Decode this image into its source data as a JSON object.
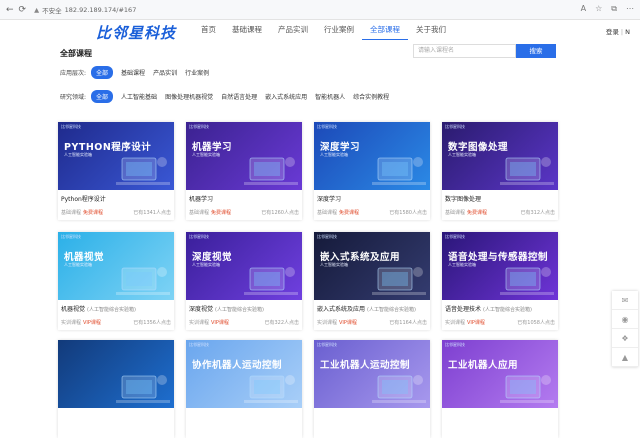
{
  "browser": {
    "security": "不安全",
    "url": "182.92.189.174/#167"
  },
  "header": {
    "logo": "比邻星科技",
    "menu": [
      "首页",
      "基础课程",
      "产品实训",
      "行业案例",
      "全部课程",
      "关于我们"
    ],
    "active_index": 4,
    "login": "登录",
    "register": "N"
  },
  "page": {
    "title": "全部课程",
    "search_placeholder": "请输入课程名",
    "search_button": "搜索"
  },
  "filters": [
    {
      "label": "应用层次:",
      "options": [
        "全部",
        "基础课程",
        "产品实训",
        "行业案例"
      ],
      "selected": 0
    },
    {
      "label": "研究领域:",
      "options": [
        "全部",
        "人工智能基础",
        "图像处理机器视觉",
        "自然语言处理",
        "嵌入式系统应用",
        "智能机器人",
        "综合实例教程"
      ],
      "selected": 0
    }
  ],
  "cards": [
    {
      "brand": "比邻星科技",
      "title": "PYTHON程序设计",
      "sub": "人工智能实验箱",
      "name": "Python程序设计",
      "note": "",
      "level": "基础课程",
      "price": "免费课程",
      "count": "已有1341人点击",
      "bg": "#1f2a8c",
      "bg2": "#3a58d6"
    },
    {
      "brand": "比邻星科技",
      "title": "机器学习",
      "sub": "人工智能实验箱",
      "name": "机器学习",
      "note": "",
      "level": "基础课程",
      "price": "免费课程",
      "count": "已有1260人点击",
      "bg": "#3b2290",
      "bg2": "#6a3ad6"
    },
    {
      "brand": "比邻星科技",
      "title": "深度学习",
      "sub": "人工智能实验箱",
      "name": "深度学习",
      "note": "",
      "level": "基础课程",
      "price": "免费课程",
      "count": "已有1580人点击",
      "bg": "#1c49b8",
      "bg2": "#2b8ae6"
    },
    {
      "brand": "比邻星科技",
      "title": "数字图像处理",
      "sub": "人工智能实验箱",
      "name": "数字图像处理",
      "note": "",
      "level": "基础课程",
      "price": "免费课程",
      "count": "已有312人点击",
      "bg": "#2a1b6e",
      "bg2": "#5b36c8"
    },
    {
      "brand": "比邻星科技",
      "title": "机器视觉",
      "sub": "人工智能实验箱",
      "name": "机器视觉",
      "note": "(人工智能综合实验箱)",
      "level": "实训课程",
      "price": "VIP课程",
      "count": "已有1356人点击",
      "bg": "#2bb0e8",
      "bg2": "#7fd3f5"
    },
    {
      "brand": "比邻星科技",
      "title": "深度视觉",
      "sub": "人工智能实验箱",
      "name": "深度视觉",
      "note": "(人工智能综合实验箱)",
      "level": "实训课程",
      "price": "VIP课程",
      "count": "已有322人点击",
      "bg": "#3a1f9a",
      "bg2": "#7040e0"
    },
    {
      "brand": "比邻星科技",
      "title": "嵌入式系统及应用",
      "sub": "人工智能实验箱",
      "name": "嵌入式系统及应用",
      "note": "(人工智能综合实验箱)",
      "level": "实训课程",
      "price": "VIP课程",
      "count": "已有1164人点击",
      "bg": "#151a3a",
      "bg2": "#343c70"
    },
    {
      "brand": "比邻星科技",
      "title": "语音处理与传感器控制",
      "sub": "人工智能实验箱",
      "name": "语音处理技术",
      "note": "(人工智能综合实验箱)",
      "level": "实训课程",
      "price": "VIP课程",
      "count": "已有1058人点击",
      "bg": "#2a1678",
      "bg2": "#6f34d8"
    },
    {
      "brand": "",
      "title": "",
      "sub": "",
      "name": "",
      "note": "",
      "level": "",
      "price": "",
      "count": "",
      "bg": "#123a7a",
      "bg2": "#1e6fd0"
    },
    {
      "brand": "比邻星科技",
      "title": "协作机器人运动控制",
      "sub": "",
      "name": "",
      "note": "",
      "level": "",
      "price": "",
      "count": "",
      "bg": "#6aa6ee",
      "bg2": "#a9cff8"
    },
    {
      "brand": "比邻星科技",
      "title": "工业机器人运动控制",
      "sub": "",
      "name": "",
      "note": "",
      "level": "",
      "price": "",
      "count": "",
      "bg": "#6a5fd0",
      "bg2": "#a899ee"
    },
    {
      "brand": "比邻星科技",
      "title": "工业机器人应用",
      "sub": "",
      "name": "",
      "note": "",
      "level": "",
      "price": "",
      "count": "",
      "bg": "#7d3fd0",
      "bg2": "#b47cf0"
    }
  ],
  "float_icons": [
    "chat-icon",
    "qq-icon",
    "wechat-icon",
    "top-icon"
  ]
}
